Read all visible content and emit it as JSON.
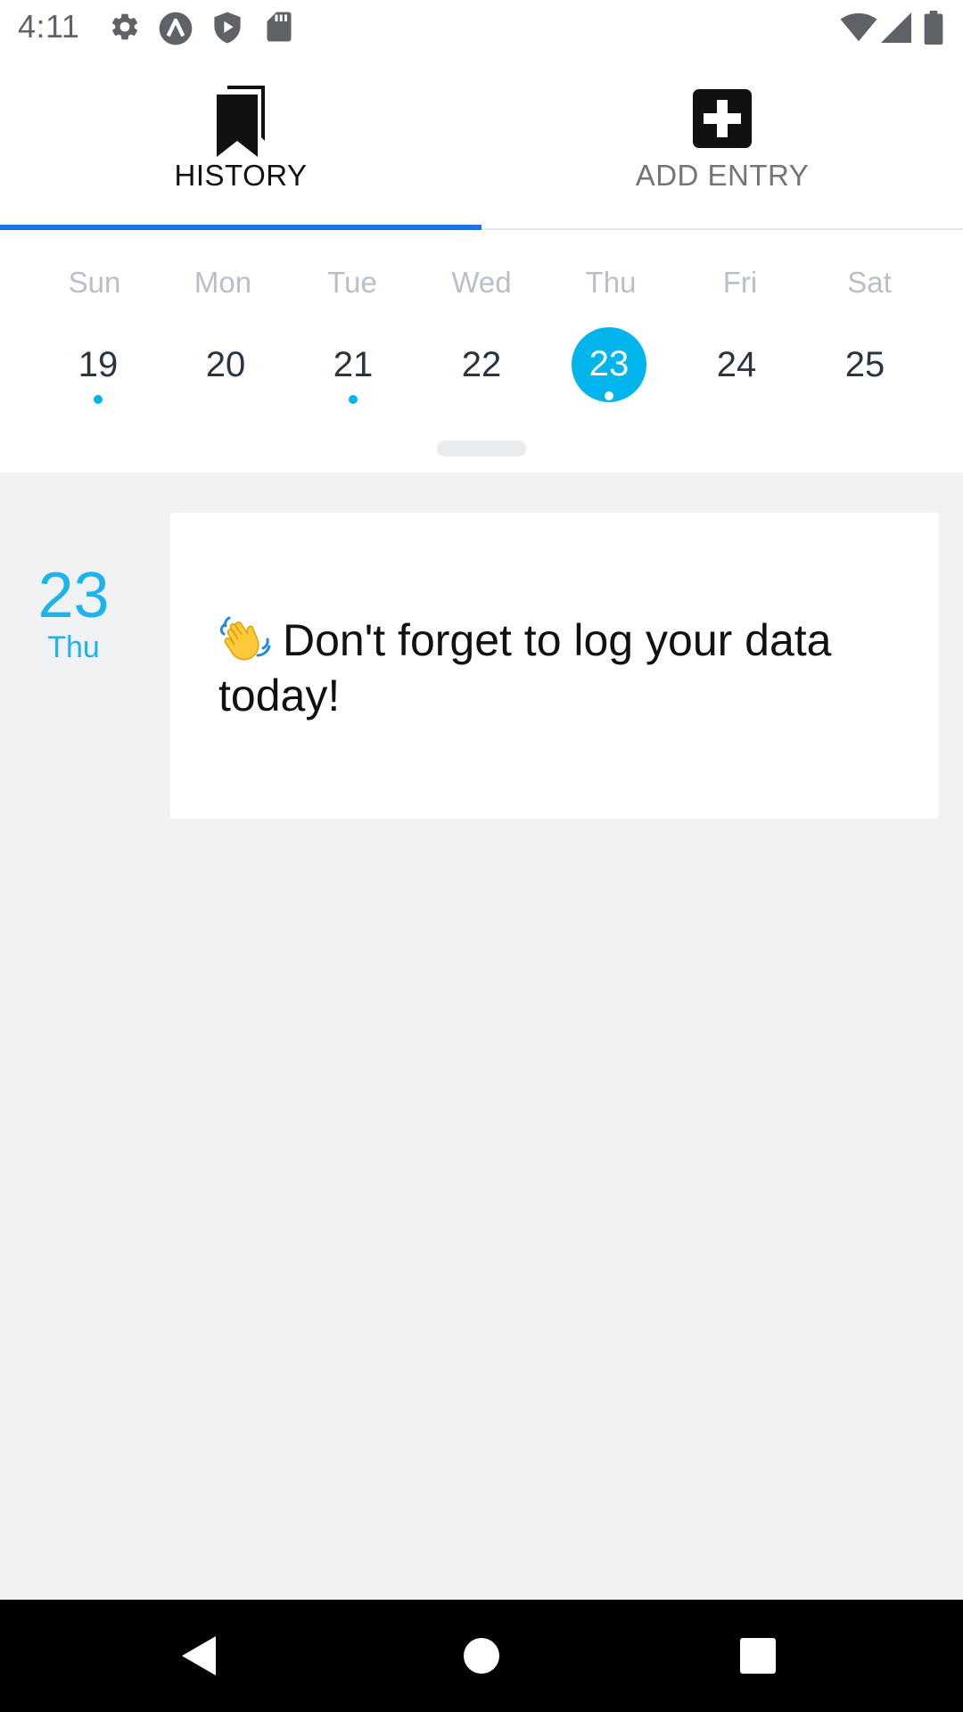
{
  "status_bar": {
    "time": "4:11",
    "icons": [
      "settings-icon",
      "app-a-icon",
      "play-protect-icon",
      "sd-card-icon",
      "wifi-icon",
      "signal-icon",
      "battery-icon"
    ]
  },
  "tabs": [
    {
      "label": "HISTORY",
      "icon": "bookmark-icon",
      "selected": true
    },
    {
      "label": "ADD ENTRY",
      "icon": "add-box-icon",
      "selected": false
    }
  ],
  "calendar": {
    "weekdays": [
      "Sun",
      "Mon",
      "Tue",
      "Wed",
      "Thu",
      "Fri",
      "Sat"
    ],
    "days": [
      {
        "num": "19",
        "has_entry": true,
        "selected": false
      },
      {
        "num": "20",
        "has_entry": false,
        "selected": false
      },
      {
        "num": "21",
        "has_entry": true,
        "selected": false
      },
      {
        "num": "22",
        "has_entry": false,
        "selected": false
      },
      {
        "num": "23",
        "has_entry": true,
        "selected": true
      },
      {
        "num": "24",
        "has_entry": false,
        "selected": false
      },
      {
        "num": "25",
        "has_entry": false,
        "selected": false
      }
    ]
  },
  "entry": {
    "date_num": "23",
    "date_day": "Thu",
    "reminder_icon": "waving-hand-icon",
    "reminder_text": "Don't forget to log your data today!"
  },
  "nav": {
    "back": "back-icon",
    "home": "home-icon",
    "recents": "recents-icon"
  },
  "colors": {
    "accent": "#00b4ec",
    "tab_indicator": "#1a73e8",
    "content_bg": "#f1f2f4"
  }
}
